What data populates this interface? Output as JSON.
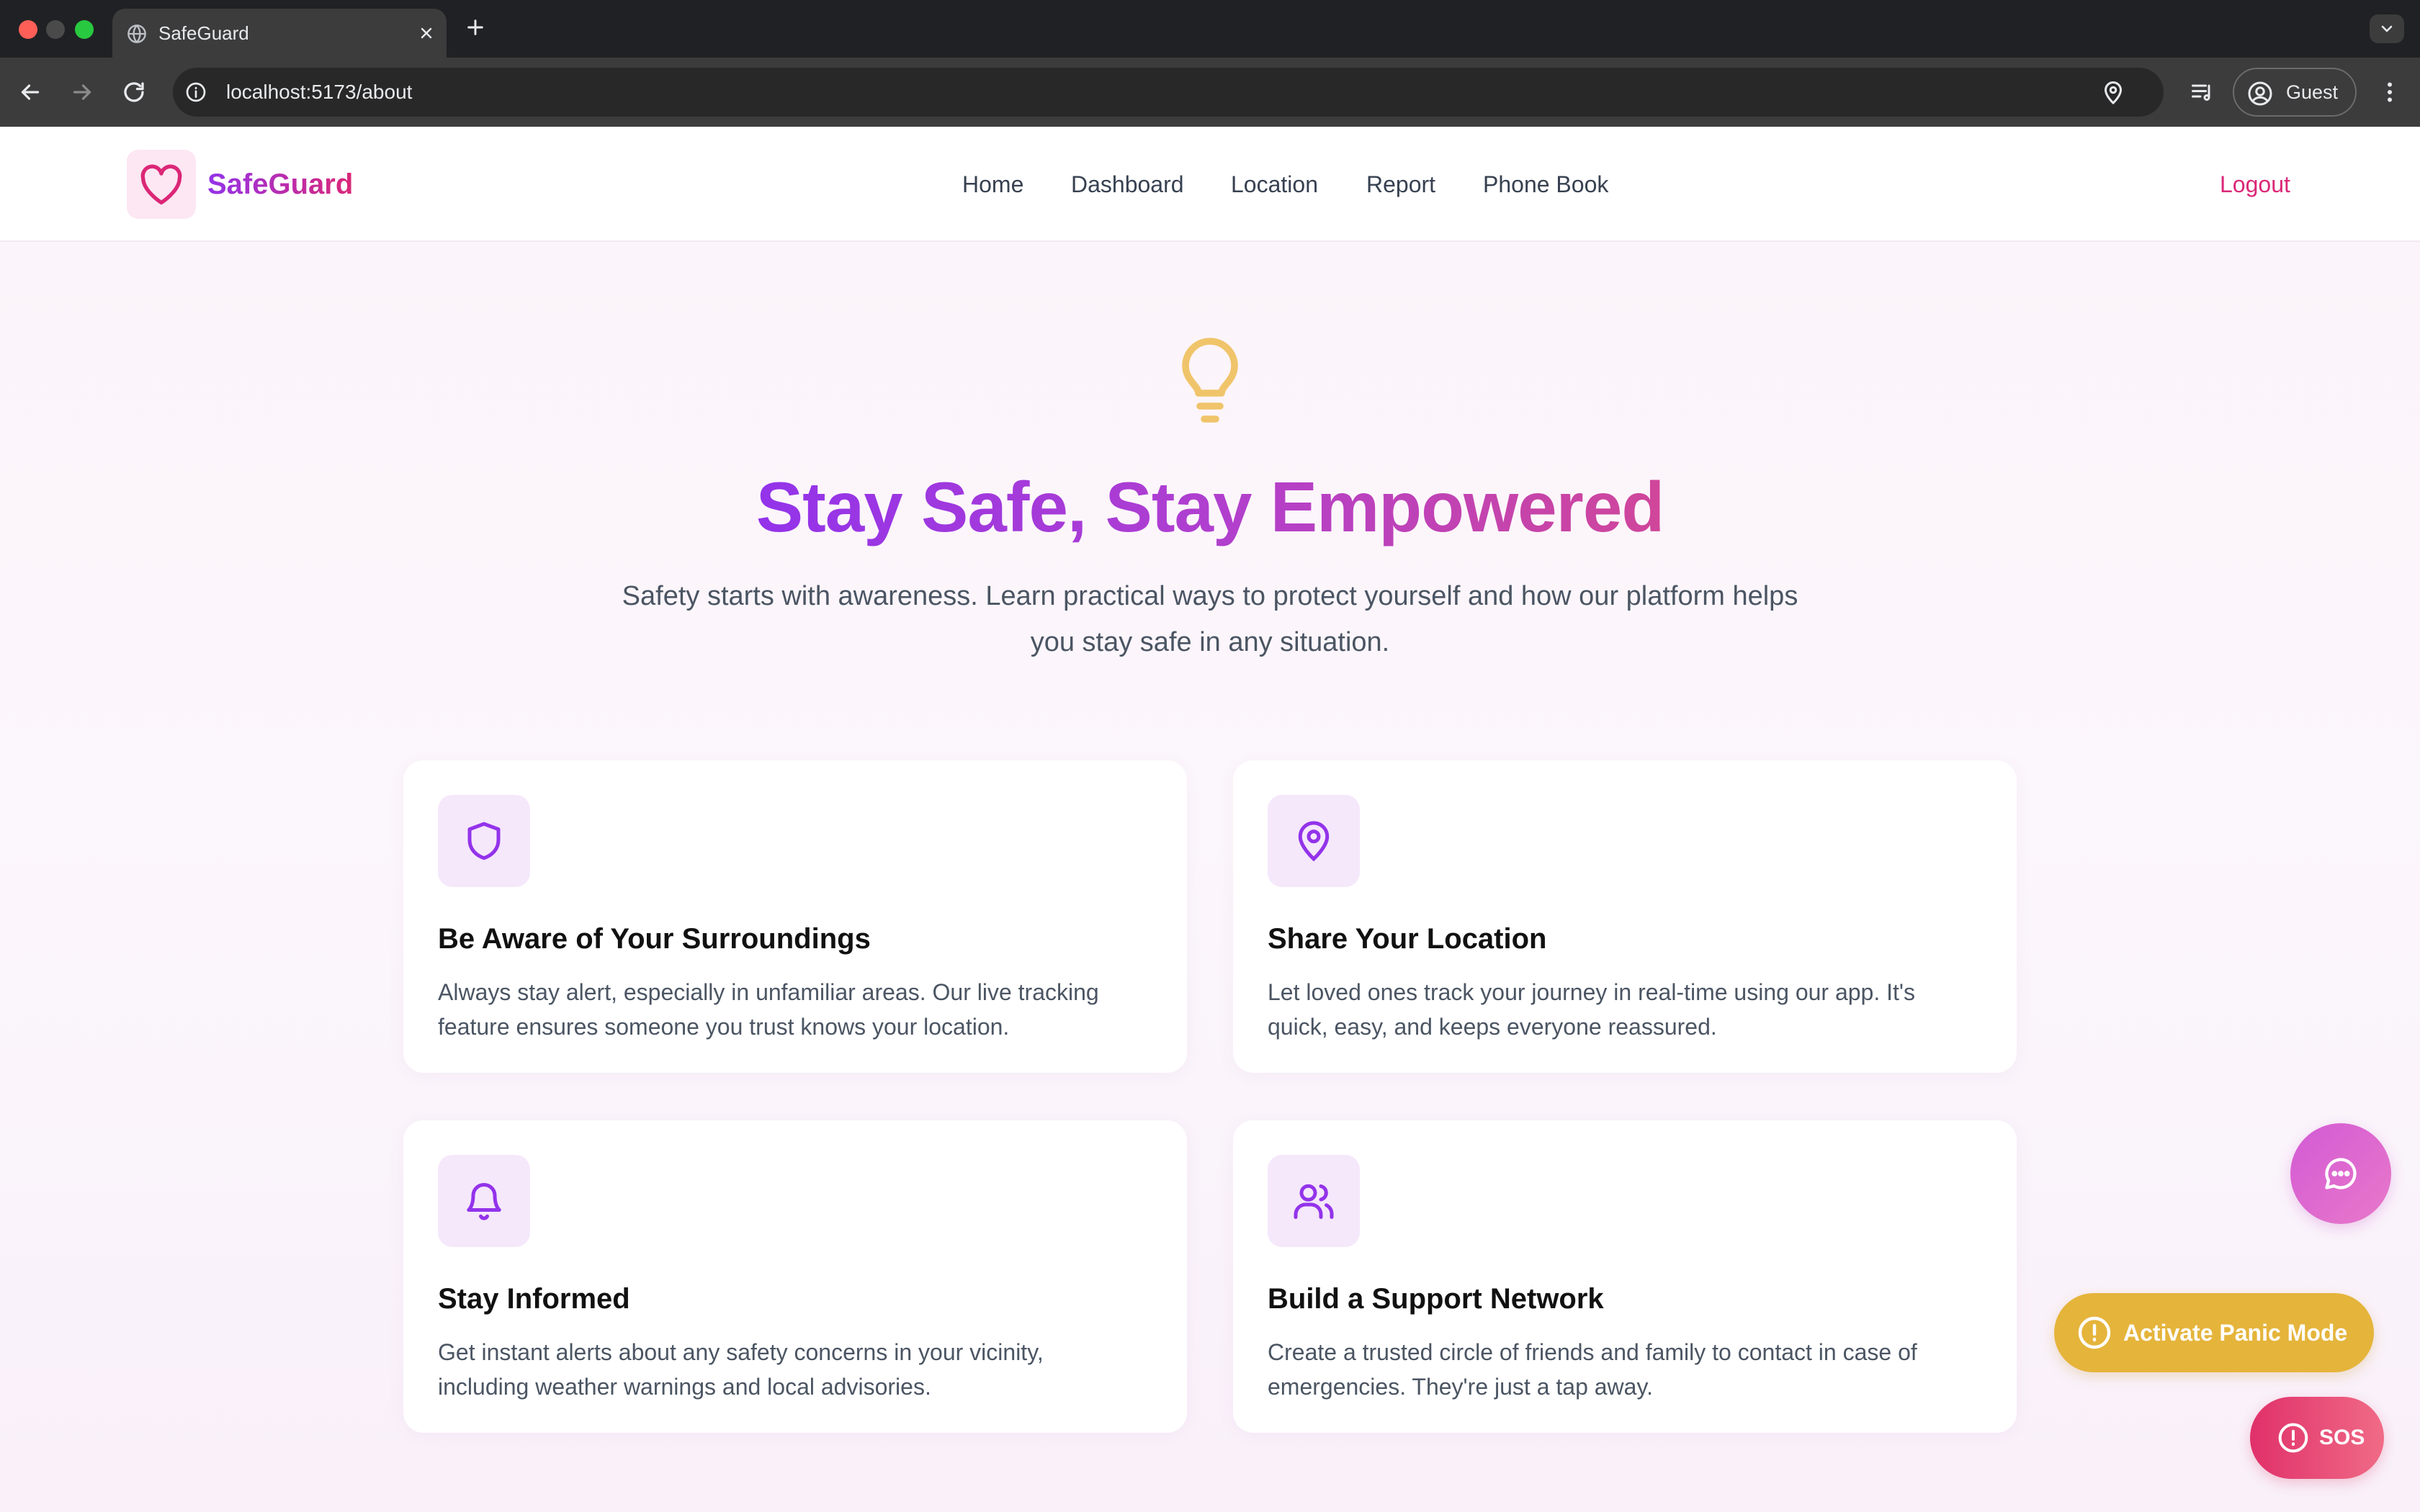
{
  "browser": {
    "tab_title": "SafeGuard",
    "url": "localhost:5173/about",
    "profile_label": "Guest"
  },
  "navbar": {
    "brand": "SafeGuard",
    "links": [
      "Home",
      "Dashboard",
      "Location",
      "Report",
      "Phone Book"
    ],
    "logout": "Logout"
  },
  "hero": {
    "icon": "lightbulb-icon",
    "title": "Stay Safe, Stay Empowered",
    "subtitle_line1": "Safety starts with awareness. Learn practical ways to protect yourself and how our platform helps",
    "subtitle_line2": "you stay safe in any situation."
  },
  "cards": [
    {
      "icon": "shield-icon",
      "title": "Be Aware of Your Surroundings",
      "desc_line1": "Always stay alert, especially in unfamiliar areas. Our live tracking",
      "desc_line2": "feature ensures someone you trust knows your location."
    },
    {
      "icon": "map-pin-icon",
      "title": "Share Your Location",
      "desc_line1": "Let loved ones track your journey in real-time using our app. It's",
      "desc_line2": "quick, easy, and keeps everyone reassured."
    },
    {
      "icon": "bell-icon",
      "title": "Stay Informed",
      "desc_line1": "Get instant alerts about any safety concerns in your vicinity,",
      "desc_line2": "including weather warnings and local advisories."
    },
    {
      "icon": "users-icon",
      "title": "Build a Support Network",
      "desc_line1": "Create a trusted circle of friends and family to contact in case of",
      "desc_line2": "emergencies. They're just a tap away."
    }
  ],
  "floating": {
    "panic_label": "Activate Panic Mode",
    "sos_label": "SOS"
  },
  "colors": {
    "brand_purple": "#9333ea",
    "brand_pink": "#db2777",
    "panic": "#e5b43b",
    "sos": "#e0306a",
    "chat": "#d35ad5"
  }
}
